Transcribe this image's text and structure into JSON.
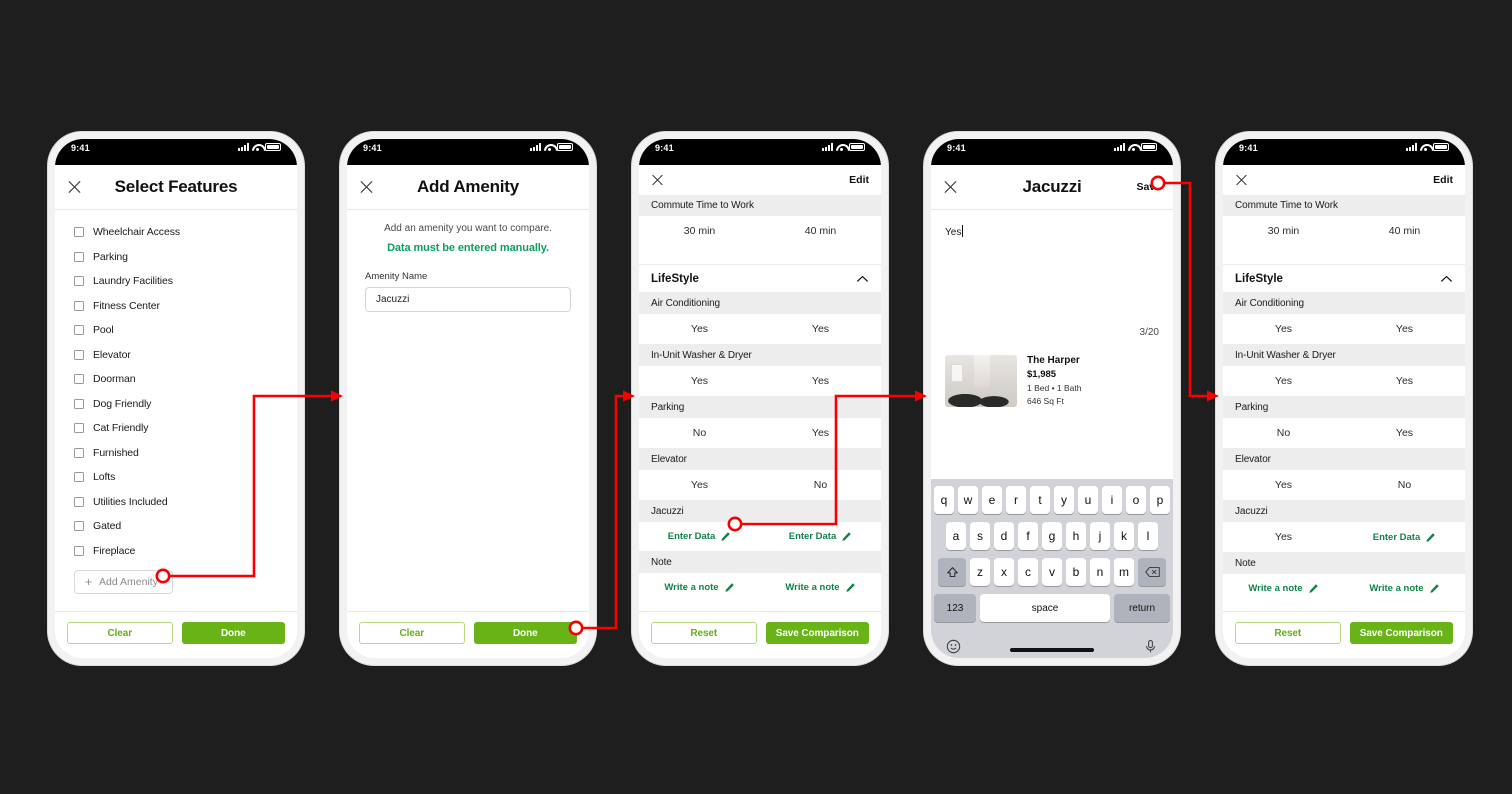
{
  "statusbar": {
    "time": "9:41"
  },
  "screen1": {
    "title": "Select Features",
    "close_icon": "close-icon",
    "features": [
      "Wheelchair Access",
      "Parking",
      "Laundry Facilities",
      "Fitness Center",
      "Pool",
      "Elevator",
      "Doorman",
      "Dog Friendly",
      "Cat Friendly",
      "Furnished",
      "Lofts",
      "Utilities Included",
      "Gated",
      "Fireplace"
    ],
    "add_amenity_label": "Add Amenity",
    "clear_label": "Clear",
    "done_label": "Done"
  },
  "screen2": {
    "title": "Add Amenity",
    "subtitle": "Add an amenity you want to compare.",
    "warning": "Data must be entered manually.",
    "field_label": "Amenity Name",
    "field_value": "Jacuzzi",
    "clear_label": "Clear",
    "done_label": "Done"
  },
  "screen3": {
    "edit_label": "Edit",
    "commute_header": "Commute Time to Work",
    "commute_left": "30 min",
    "commute_right": "40 min",
    "group_title": "LifeStyle",
    "rows": [
      {
        "label": "Air Conditioning",
        "left": "Yes",
        "right": "Yes",
        "left_link": false,
        "right_link": false
      },
      {
        "label": "In-Unit Washer & Dryer",
        "left": "Yes",
        "right": "Yes",
        "left_link": false,
        "right_link": false
      },
      {
        "label": "Parking",
        "left": "No",
        "right": "Yes",
        "left_link": false,
        "right_link": false
      },
      {
        "label": "Elevator",
        "left": "Yes",
        "right": "No",
        "left_link": false,
        "right_link": false
      },
      {
        "label": "Jacuzzi",
        "left": "Enter Data",
        "right": "Enter Data",
        "left_link": true,
        "right_link": true
      },
      {
        "label": "Note",
        "left": "Write a note",
        "right": "Write a note",
        "left_link": true,
        "right_link": true
      }
    ],
    "reset_label": "Reset",
    "save_label": "Save Comparison"
  },
  "screen4": {
    "title": "Jacuzzi",
    "save_label": "Save",
    "note_value": "Yes",
    "counter": "3/20",
    "listing": {
      "name": "The Harper",
      "price": "$1,985",
      "beds": "1 Bed • 1 Bath",
      "sqft": "646 Sq Ft"
    },
    "keyboard": {
      "row1": [
        "q",
        "w",
        "e",
        "r",
        "t",
        "y",
        "u",
        "i",
        "o",
        "p"
      ],
      "row2": [
        "a",
        "s",
        "d",
        "f",
        "g",
        "h",
        "j",
        "k",
        "l"
      ],
      "row3": [
        "z",
        "x",
        "c",
        "v",
        "b",
        "n",
        "m"
      ],
      "shift_icon": "shift-icon",
      "backspace_icon": "backspace-icon",
      "num_label": "123",
      "space_label": "space",
      "return_label": "return",
      "emoji_icon": "emoji-icon",
      "mic_icon": "microphone-icon"
    }
  },
  "screen5": {
    "edit_label": "Edit",
    "commute_header": "Commute Time to Work",
    "commute_left": "30 min",
    "commute_right": "40 min",
    "group_title": "LifeStyle",
    "rows": [
      {
        "label": "Air Conditioning",
        "left": "Yes",
        "right": "Yes",
        "left_link": false,
        "right_link": false
      },
      {
        "label": "In-Unit Washer & Dryer",
        "left": "Yes",
        "right": "Yes",
        "left_link": false,
        "right_link": false
      },
      {
        "label": "Parking",
        "left": "No",
        "right": "Yes",
        "left_link": false,
        "right_link": false
      },
      {
        "label": "Elevator",
        "left": "Yes",
        "right": "No",
        "left_link": false,
        "right_link": false
      },
      {
        "label": "Jacuzzi",
        "left": "Yes",
        "right": "Enter Data",
        "left_link": false,
        "right_link": true
      },
      {
        "label": "Note",
        "left": "Write a note",
        "right": "Write a note",
        "left_link": true,
        "right_link": true
      }
    ],
    "reset_label": "Reset",
    "save_label": "Save Comparison"
  },
  "colors": {
    "background": "#1e1e1e",
    "green_primary": "#68b316",
    "green_link": "#12824a",
    "annotation_red": "#f90000",
    "row_header_gray": "#ededed"
  }
}
